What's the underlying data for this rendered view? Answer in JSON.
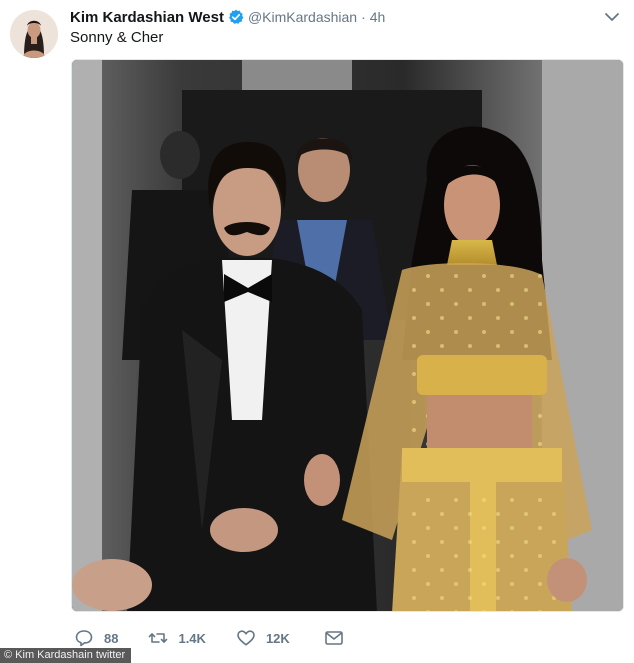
{
  "tweet": {
    "display_name": "Kim Kardashian West",
    "handle": "@KimKardashian",
    "separator": "·",
    "time": "4h",
    "text": "Sonny & Cher",
    "verified": true
  },
  "actions": {
    "reply_count": "88",
    "retweet_count": "1.4K",
    "like_count": "12K"
  },
  "icons": {
    "reply": "reply-icon",
    "retweet": "retweet-icon",
    "like": "heart-icon",
    "message": "mail-icon",
    "menu": "chevron-down-icon",
    "verified": "verified-badge-icon"
  },
  "colors": {
    "verified": "#1da1f2",
    "secondary_text": "#657786",
    "primary_text": "#14171a"
  },
  "watermark": "© Kim Kardashain twitter"
}
